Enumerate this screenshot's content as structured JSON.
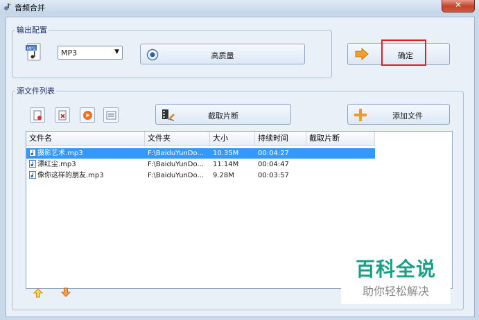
{
  "window": {
    "title": "音频合并",
    "close_glyph": "✕"
  },
  "output_group": {
    "legend": "输出配置",
    "format_value": "MP3",
    "quality_label": "高质量",
    "confirm_label": "确定"
  },
  "source_group": {
    "legend": "源文件列表",
    "clip_label": "截取片断",
    "add_file_label": "添加文件"
  },
  "table": {
    "columns": [
      "文件名",
      "文件夹",
      "大小",
      "持续时间",
      "截取片断"
    ],
    "rows": [
      {
        "name": "摄影艺术.mp3",
        "folder": "F:\\BaiduYunDo...",
        "size": "10.35M",
        "duration": "00:04:27",
        "clip": "",
        "selected": true
      },
      {
        "name": "漂红尘.mp3",
        "folder": "F:\\BaiduYunDo...",
        "size": "11.14M",
        "duration": "00:04:47",
        "clip": "",
        "selected": false
      },
      {
        "name": "像你这样的朋友.mp3",
        "folder": "F:\\BaiduYunDo...",
        "size": "9.28M",
        "duration": "00:03:57",
        "clip": "",
        "selected": false
      }
    ]
  },
  "watermark": {
    "main": "百科全说",
    "sub": "助你轻松解决"
  },
  "colors": {
    "selection": "#3399ff",
    "highlight_border": "#e02020",
    "watermark": "#16a085"
  }
}
